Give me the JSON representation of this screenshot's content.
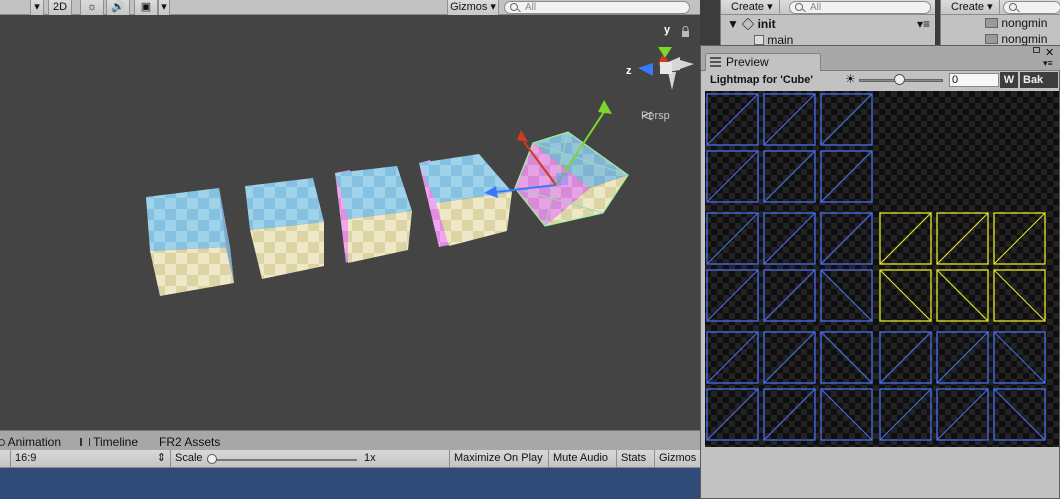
{
  "scene_toolbar": {
    "dim_label": "2D",
    "gizmos_label": "Gizmos",
    "search_placeholder": "All"
  },
  "scene": {
    "camera_label": "Persp",
    "axis_y": "y",
    "axis_z": "z"
  },
  "hierarchy": {
    "create_label": "Create",
    "search_placeholder": "All",
    "scene_name": "init",
    "item_main": "main"
  },
  "project": {
    "create_label": "Create",
    "folders": [
      "nongmin",
      "nongmin"
    ]
  },
  "preview": {
    "tab_label": "Preview",
    "lightmap_title": "Lightmap for 'Cube'",
    "exposure_value": "0",
    "w_label": "W",
    "bake_label": "Bak",
    "exposure_level": 0.6
  },
  "bottom_tabs": [
    "Animation",
    "Timeline",
    "FR2 Assets"
  ],
  "game_bar": {
    "aspect": "16:9",
    "scale_label": "Scale",
    "scale_value": "1x",
    "maximize_label": "Maximize On Play",
    "mute_label": "Mute Audio",
    "stats_label": "Stats",
    "gizmos_label": "Gizmos"
  },
  "colors": {
    "uv_blue": "#4a6ff0",
    "uv_yellow": "#e6e62a",
    "game_bg": "#304b78",
    "scene_bg": "#444444"
  }
}
